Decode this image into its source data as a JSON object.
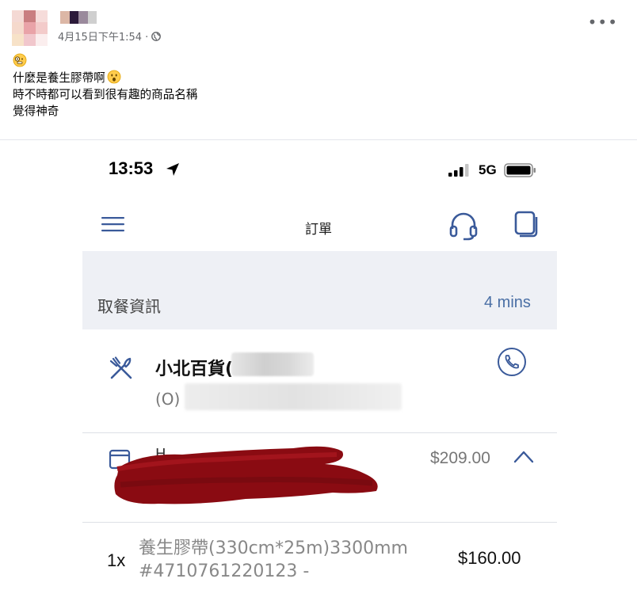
{
  "post": {
    "timestamp": "4月15日下午1:54 ·",
    "lines": [
      "什麼是養生膠帶啊",
      "時不時都可以看到很有趣的商品名稱",
      "覺得神奇"
    ],
    "icons": {
      "leading_emoji": "grimacing-monocle-emoji",
      "trailing_emoji": "surprised-face-emoji",
      "privacy": "globe-icon",
      "more": "more-options-icon"
    }
  },
  "phone": {
    "status_bar": {
      "time": "13:53",
      "network": "5G"
    },
    "nav": {
      "title": "訂單"
    },
    "pickup": {
      "label": "取餐資訊",
      "time": "4 mins"
    },
    "store": {
      "name": "小北百貨(",
      "sub": "(O)"
    },
    "order": {
      "label": "H",
      "total": "$209.00"
    },
    "item": {
      "qty": "1x",
      "name_line1": "養生膠帶(330cm*25m)3300mm",
      "name_line2": "#4710761220123 -",
      "price": "$160.00"
    }
  },
  "colors": {
    "accent_blue": "#3a5a9a",
    "link_blue": "#4a6fa5",
    "scribble_red": "#8a0b12",
    "band_gray": "#eef0f5"
  }
}
